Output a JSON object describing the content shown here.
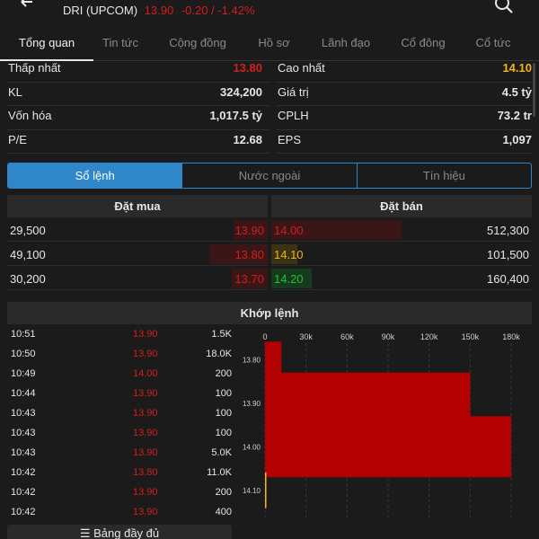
{
  "header": {
    "back_icon": "arrow-left-icon",
    "ticker_name": "DRI (UPCOM)",
    "ticker_price": "13.90",
    "ticker_change": "-0.20 / -1.42%",
    "search_icon": "search-icon"
  },
  "tabs": [
    {
      "label": "Tổng quan",
      "active": true
    },
    {
      "label": "Tin tức"
    },
    {
      "label": "Cộng đồng"
    },
    {
      "label": "Hồ sơ"
    },
    {
      "label": "Lãnh đạo"
    },
    {
      "label": "Cổ đông"
    },
    {
      "label": "Cổ tức"
    }
  ],
  "stats": {
    "low_label": "Thấp nhất",
    "low_value": "13.80",
    "high_label": "Cao nhất",
    "high_value": "14.10",
    "vol_label": "KL",
    "vol_value": "324,200",
    "value_label": "Giá trị",
    "value_value": "4.5 tỷ",
    "mcap_label": "Vốn hóa",
    "mcap_value": "1,017.5 tỷ",
    "shares_label": "CPLH",
    "shares_value": "73.2 tr",
    "pe_label": "P/E",
    "pe_value": "12.68",
    "eps_label": "EPS",
    "eps_value": "1,097"
  },
  "segments": [
    {
      "label": "Sổ lệnh",
      "active": true
    },
    {
      "label": "Nước ngoài"
    },
    {
      "label": "Tín hiệu"
    }
  ],
  "orderbook": {
    "buy_title": "Đặt mua",
    "sell_title": "Đặt bán",
    "buy": [
      {
        "volume": "29,500",
        "price": "13.90",
        "ratio": 0.58
      },
      {
        "volume": "49,100",
        "price": "13.80",
        "ratio": 1.0
      },
      {
        "volume": "30,200",
        "price": "13.70",
        "ratio": 0.61
      }
    ],
    "sell": [
      {
        "price": "14.00",
        "volume": "512,300",
        "ratio": 1.0
      },
      {
        "price": "14.10",
        "volume": "101,500",
        "ratio": 0.2
      },
      {
        "price": "14.20",
        "volume": "160,400",
        "ratio": 0.31
      }
    ]
  },
  "trades": {
    "title": "Khớp lệnh",
    "rows": [
      {
        "time": "10:51",
        "price": "13.90",
        "volume": "1.5K"
      },
      {
        "time": "10:50",
        "price": "13.90",
        "volume": "18.0K"
      },
      {
        "time": "10:49",
        "price": "14.00",
        "volume": "200"
      },
      {
        "time": "10:44",
        "price": "13.90",
        "volume": "100"
      },
      {
        "time": "10:43",
        "price": "13.90",
        "volume": "100"
      },
      {
        "time": "10:43",
        "price": "13.90",
        "volume": "100"
      },
      {
        "time": "10:43",
        "price": "13.90",
        "volume": "5.0K"
      },
      {
        "time": "10:42",
        "price": "13.80",
        "volume": "11.0K"
      },
      {
        "time": "10:42",
        "price": "13.90",
        "volume": "200"
      },
      {
        "time": "10:42",
        "price": "13.90",
        "volume": "400"
      }
    ],
    "full_button": "Bảng đầy đủ",
    "full_button_icon": "list-icon"
  },
  "colors": {
    "red": "#d41e1e",
    "yellow": "#f3b41c",
    "green": "#1fc23a",
    "accent": "#2f86c9",
    "bar": "#b30000"
  },
  "chart_data": {
    "type": "bar",
    "orientation": "horizontal",
    "categories": [
      "13.80",
      "13.90",
      "14.00",
      "14.10"
    ],
    "values": [
      12000,
      150000,
      180000,
      1000
    ],
    "x_ticks": [
      "0",
      "30k",
      "60k",
      "90k",
      "120k",
      "150k",
      "180k"
    ],
    "xlim": [
      0,
      180000
    ]
  }
}
